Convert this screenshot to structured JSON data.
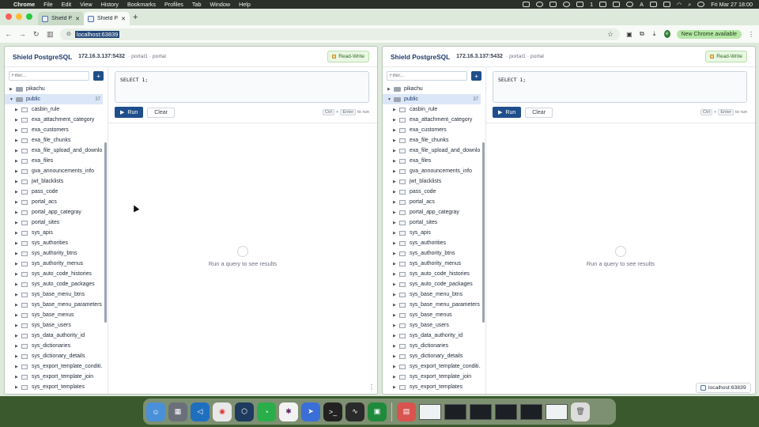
{
  "menubar": {
    "app": "Chrome",
    "items": [
      "File",
      "Edit",
      "View",
      "History",
      "Bookmarks",
      "Profiles",
      "Tab",
      "Window",
      "Help"
    ],
    "status_count": "1",
    "clock": "Fri Mar 27  18:00",
    "input_badge": "A"
  },
  "browser": {
    "tabs": [
      {
        "label": "Shield P..."
      },
      {
        "label": "Shield P..."
      }
    ],
    "url": "localhost:63839",
    "profile_initial": "e",
    "new_chrome_label": "New Chrome available"
  },
  "panes": [
    {
      "title": "Shield PostgreSQL",
      "host": "172.16.3.137:5432",
      "db_path": "· portal1 · portal",
      "mode_badge": "Read-Write",
      "filter_placeholder": "Filter...",
      "add_label": "+",
      "databases": [
        {
          "name": "pikachu",
          "expanded": false
        },
        {
          "name": "public",
          "expanded": true,
          "count": "37"
        }
      ],
      "query": "SELECT 1;",
      "run_label": "Run",
      "clear_label": "Clear",
      "hint": {
        "key1": "Ctrl",
        "plus": "+",
        "key2": "Enter",
        "suffix": "to run"
      },
      "empty_text": "Run a query to see results"
    },
    {
      "title": "Shield PostgreSQL",
      "host": "172.16.3.137:5432",
      "db_path": "· portal1 · portal",
      "mode_badge": "Read-Write",
      "filter_placeholder": "Filter...",
      "add_label": "+",
      "databases": [
        {
          "name": "pikachu",
          "expanded": false
        },
        {
          "name": "public",
          "expanded": true,
          "count": "37"
        }
      ],
      "query": "SELECT 1;",
      "run_label": "Run",
      "clear_label": "Clear",
      "hint": {
        "key1": "Ctrl",
        "plus": "+",
        "key2": "Enter",
        "suffix": "to run"
      },
      "empty_text": "Run a query to see results"
    }
  ],
  "tables": [
    "casbin_rule",
    "exa_attachment_category",
    "exa_customers",
    "exa_file_chunks",
    "exa_file_upload_and_downlo...",
    "exa_files",
    "gva_announcements_info",
    "jwt_blacklists",
    "pass_code",
    "portal_acs",
    "portal_app_categray",
    "portal_sites",
    "sys_apis",
    "sys_authorities",
    "sys_authority_btns",
    "sys_authority_menus",
    "sys_auto_code_histories",
    "sys_auto_code_packages",
    "sys_base_menu_btns",
    "sys_base_menu_parameters",
    "sys_base_menus",
    "sys_base_users",
    "sys_data_authority_id",
    "sys_dictionaries",
    "sys_dictionary_details",
    "sys_export_template_conditi...",
    "sys_export_template_join",
    "sys_export_templates"
  ],
  "status_pill": "localhost:63839",
  "colors": {
    "accent": "#1f4e8c",
    "title": "#1e3a6e",
    "badge_bg": "#e9f7e3",
    "new_chrome_bg": "#b6e6a6"
  },
  "icons": {
    "tab_favicon": "shield-favicon",
    "run": "play-icon",
    "empty": "query-empty-icon",
    "database": "database-icon",
    "table": "table-icon"
  }
}
